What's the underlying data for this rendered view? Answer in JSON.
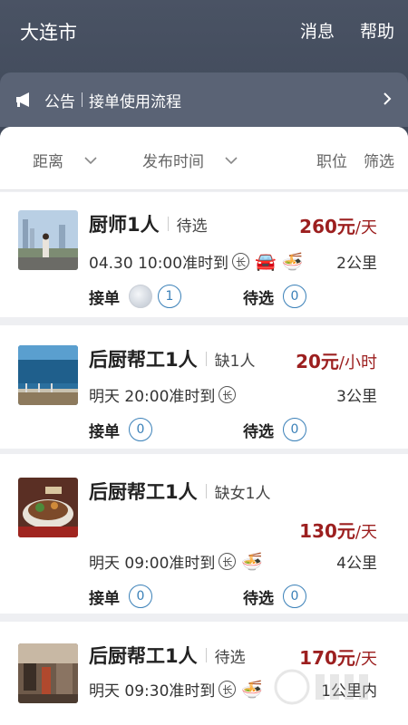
{
  "header": {
    "city": "大连市",
    "messages": "消息",
    "help": "帮助"
  },
  "notice": {
    "label": "公告",
    "text": "接单使用流程"
  },
  "filters": {
    "distance": "距离",
    "publish_time": "发布时间",
    "position": "职位",
    "filter": "筛选"
  },
  "jobs": [
    {
      "title": "厨师1人",
      "sub": "待选",
      "price": "260元",
      "unit": "/天",
      "time": "04.30 10:00准时到",
      "long_icon": "长",
      "extra_icons": [
        "🚘",
        "🍜"
      ],
      "distance": "2公里",
      "accept_label": "接单",
      "accept_count": "1",
      "pending_label": "待选",
      "pending_count": "0"
    },
    {
      "title": "后厨帮工1人",
      "sub": "缺1人",
      "price": "20元",
      "unit": "/小时",
      "time": "明天 20:00准时到",
      "long_icon": "长",
      "distance": "3公里",
      "accept_label": "接单",
      "accept_count": "0",
      "pending_label": "待选",
      "pending_count": "0"
    },
    {
      "title": "后厨帮工1人",
      "sub": "缺女1人",
      "price": "130元",
      "unit": "/天",
      "time": "明天 09:00准时到",
      "long_icon": "长",
      "extra_icons": [
        "🍜"
      ],
      "distance": "4公里",
      "accept_label": "接单",
      "accept_count": "0",
      "pending_label": "待选",
      "pending_count": "0"
    },
    {
      "title": "后厨帮工1人",
      "sub": "待选",
      "price": "170元",
      "unit": "/天",
      "time": "明天 09:30准时到",
      "long_icon": "长",
      "extra_icons": [
        "🍜"
      ],
      "distance": "1公里内"
    }
  ],
  "colors": {
    "header_bg": "#4a5364",
    "price": "#9c1f1f",
    "badge": "#3a80b8"
  }
}
